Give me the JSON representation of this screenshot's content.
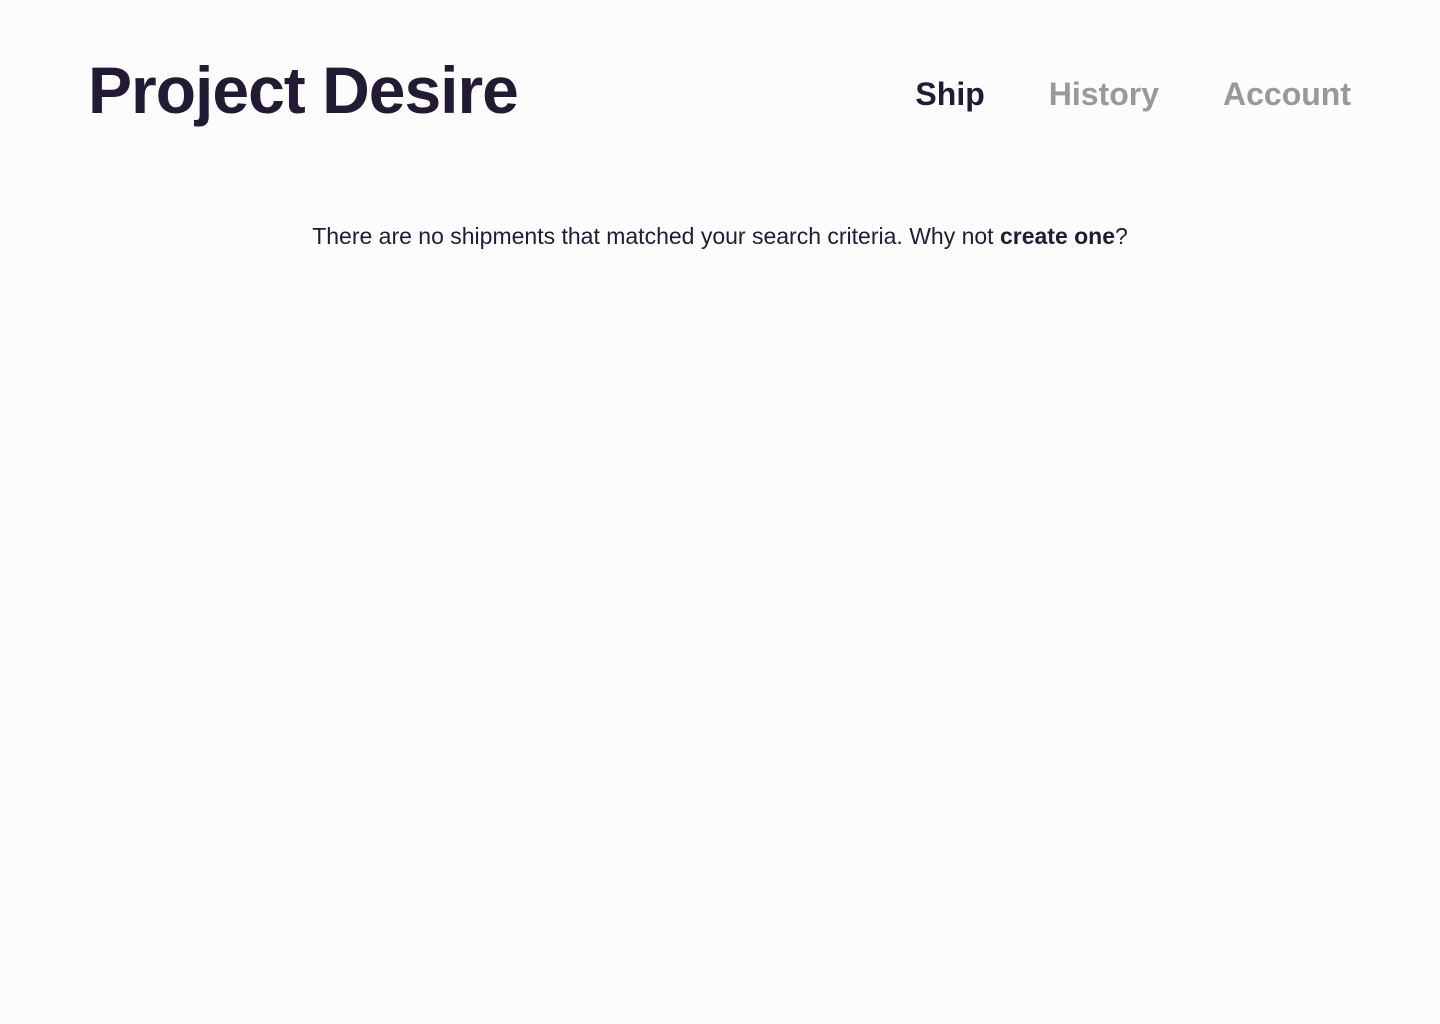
{
  "header": {
    "title": "Project Desire",
    "nav": [
      {
        "label": "Ship",
        "active": true
      },
      {
        "label": "History",
        "active": false
      },
      {
        "label": "Account",
        "active": false
      }
    ]
  },
  "main": {
    "empty_message": {
      "prefix": "There are no shipments that matched your search criteria. Why not ",
      "link_label": "create one",
      "suffix": "?"
    }
  },
  "colors": {
    "text": "#221b33",
    "nav_inactive": "#999999",
    "background": "#fcfcfc"
  }
}
